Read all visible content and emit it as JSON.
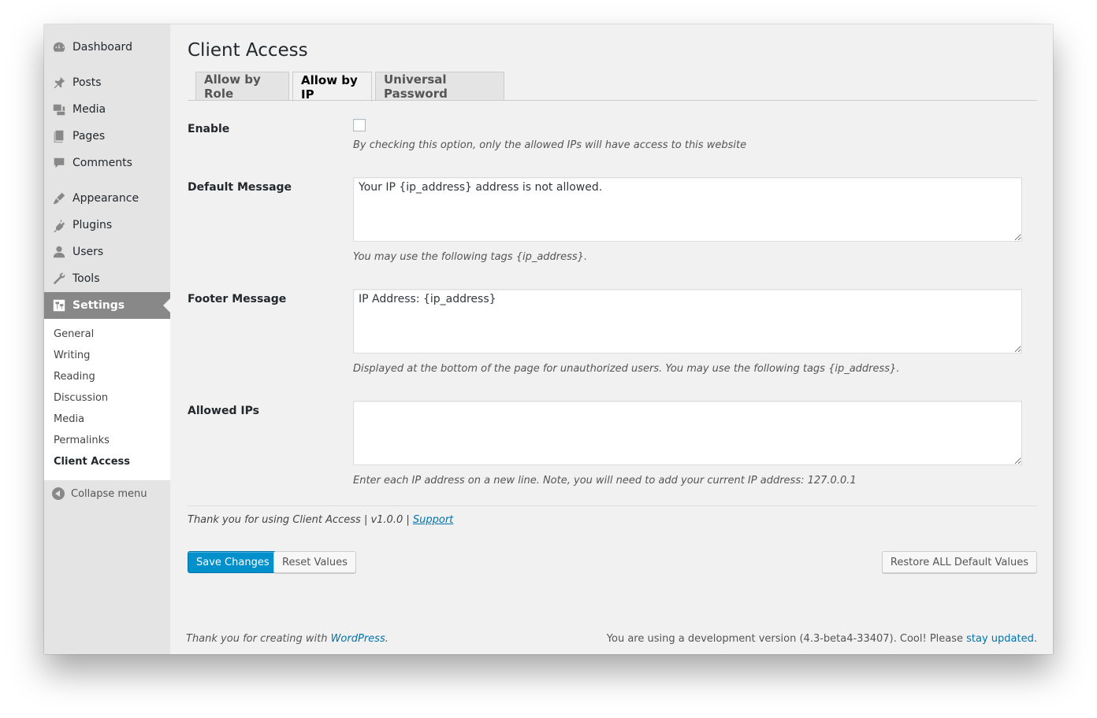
{
  "sidebar": {
    "items": [
      {
        "label": "Dashboard",
        "icon": "dashboard-icon"
      },
      {
        "label": "Posts",
        "icon": "pin-icon"
      },
      {
        "label": "Media",
        "icon": "media-icon"
      },
      {
        "label": "Pages",
        "icon": "pages-icon"
      },
      {
        "label": "Comments",
        "icon": "comment-icon"
      },
      {
        "label": "Appearance",
        "icon": "brush-icon"
      },
      {
        "label": "Plugins",
        "icon": "plug-icon"
      },
      {
        "label": "Users",
        "icon": "user-icon"
      },
      {
        "label": "Tools",
        "icon": "wrench-icon"
      },
      {
        "label": "Settings",
        "icon": "settings-icon"
      }
    ],
    "submenu": [
      "General",
      "Writing",
      "Reading",
      "Discussion",
      "Media",
      "Permalinks",
      "Client Access"
    ],
    "collapse_label": "Collapse menu"
  },
  "page": {
    "title": "Client Access",
    "tabs": [
      "Allow by Role",
      "Allow by IP",
      "Universal Password"
    ],
    "active_tab": "Allow by IP"
  },
  "form": {
    "enable": {
      "label": "Enable",
      "checked": false,
      "description": "By checking this option, only the allowed IPs will have access to this website"
    },
    "default_message": {
      "label": "Default Message",
      "value": "Your IP {ip_address} address is not allowed.",
      "description": "You may use the following tags {ip_address}."
    },
    "footer_message": {
      "label": "Footer Message",
      "value": "IP Address: {ip_address}",
      "description": "Displayed at the bottom of the page for unauthorized users. You may use the following tags {ip_address}."
    },
    "allowed_ips": {
      "label": "Allowed IPs",
      "value": "",
      "description": "Enter each IP address on a new line. Note, you will need to add your current IP address: 127.0.0.1"
    }
  },
  "plugin_footer": {
    "thanks_text": "Thank you for using Client Access | v1.0.0 | ",
    "support_link": "Support"
  },
  "buttons": {
    "save": "Save Changes",
    "reset": "Reset Values",
    "restore": "Restore ALL Default Values"
  },
  "wp_footer": {
    "left_text": "Thank you for creating with ",
    "left_link": "WordPress",
    "left_end": ".",
    "right_text": "You are using a development version (4.3-beta4-33407). Cool! Please ",
    "right_link": "stay updated",
    "right_end": "."
  },
  "colors": {
    "accent": "#0091cd",
    "link": "#0073aa",
    "sidebar_bg": "#e4e4e4",
    "active_menu": "#888888"
  }
}
